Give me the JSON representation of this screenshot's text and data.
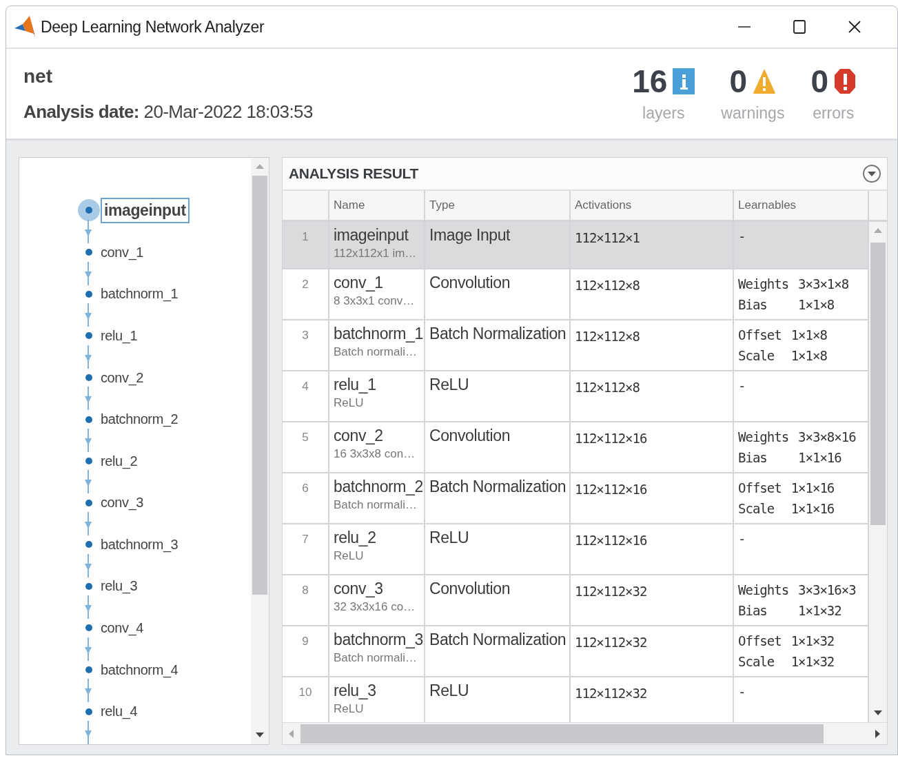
{
  "window": {
    "title": "Deep Learning Network Analyzer"
  },
  "header": {
    "network": "net",
    "date_label": "Analysis date:",
    "date_value": "20-Mar-2022 18:03:53"
  },
  "summary": [
    {
      "kind": "info",
      "count": "16",
      "label": "layers"
    },
    {
      "kind": "warning",
      "count": "0",
      "label": "warnings"
    },
    {
      "kind": "error",
      "count": "0",
      "label": "errors"
    }
  ],
  "graph": {
    "nodes": [
      {
        "label": "imageinput",
        "selected": true
      },
      {
        "label": "conv_1",
        "selected": false
      },
      {
        "label": "batchnorm_1",
        "selected": false
      },
      {
        "label": "relu_1",
        "selected": false
      },
      {
        "label": "conv_2",
        "selected": false
      },
      {
        "label": "batchnorm_2",
        "selected": false
      },
      {
        "label": "relu_2",
        "selected": false
      },
      {
        "label": "conv_3",
        "selected": false
      },
      {
        "label": "batchnorm_3",
        "selected": false
      },
      {
        "label": "relu_3",
        "selected": false
      },
      {
        "label": "conv_4",
        "selected": false
      },
      {
        "label": "batchnorm_4",
        "selected": false
      },
      {
        "label": "relu_4",
        "selected": false
      }
    ]
  },
  "analysis": {
    "title": "ANALYSIS RESULT",
    "columns": [
      "Name",
      "Type",
      "Activations",
      "Learnables"
    ],
    "rows": [
      {
        "index": "1",
        "name": "imageinput",
        "description": "112x112x1 im…",
        "type": "Image Input",
        "activations": "112×112×1",
        "learnables": [
          {
            "name": "-"
          }
        ],
        "selected": true
      },
      {
        "index": "2",
        "name": "conv_1",
        "description": "8 3x3x1 conv…",
        "type": "Convolution",
        "activations": "112×112×8",
        "learnables": [
          {
            "name": "Weights",
            "size": "3×3×1×8"
          },
          {
            "name": "Bias",
            "size": "1×1×8"
          }
        ],
        "selected": false
      },
      {
        "index": "3",
        "name": "batchnorm_1",
        "description": "Batch normali…",
        "type": "Batch Normalization",
        "activations": "112×112×8",
        "learnables": [
          {
            "name": "Offset",
            "size": "1×1×8"
          },
          {
            "name": "Scale",
            "size": "1×1×8"
          }
        ],
        "selected": false
      },
      {
        "index": "4",
        "name": "relu_1",
        "description": "ReLU",
        "type": "ReLU",
        "activations": "112×112×8",
        "learnables": [
          {
            "name": "-"
          }
        ],
        "selected": false
      },
      {
        "index": "5",
        "name": "conv_2",
        "description": "16 3x3x8 con…",
        "type": "Convolution",
        "activations": "112×112×16",
        "learnables": [
          {
            "name": "Weights",
            "size": "3×3×8×16"
          },
          {
            "name": "Bias",
            "size": "1×1×16"
          }
        ],
        "selected": false
      },
      {
        "index": "6",
        "name": "batchnorm_2",
        "description": "Batch normali…",
        "type": "Batch Normalization",
        "activations": "112×112×16",
        "learnables": [
          {
            "name": "Offset",
            "size": "1×1×16"
          },
          {
            "name": "Scale",
            "size": "1×1×16"
          }
        ],
        "selected": false
      },
      {
        "index": "7",
        "name": "relu_2",
        "description": "ReLU",
        "type": "ReLU",
        "activations": "112×112×16",
        "learnables": [
          {
            "name": "-"
          }
        ],
        "selected": false
      },
      {
        "index": "8",
        "name": "conv_3",
        "description": "32 3x3x16 co…",
        "type": "Convolution",
        "activations": "112×112×32",
        "learnables": [
          {
            "name": "Weights",
            "size": "3×3×16×3"
          },
          {
            "name": "Bias",
            "size": "1×1×32"
          }
        ],
        "selected": false
      },
      {
        "index": "9",
        "name": "batchnorm_3",
        "description": "Batch normali…",
        "type": "Batch Normalization",
        "activations": "112×112×32",
        "learnables": [
          {
            "name": "Offset",
            "size": "1×1×32"
          },
          {
            "name": "Scale",
            "size": "1×1×32"
          }
        ],
        "selected": false
      },
      {
        "index": "10",
        "name": "relu_3",
        "description": "ReLU",
        "type": "ReLU",
        "activations": "112×112×32",
        "learnables": [
          {
            "name": "-"
          }
        ],
        "selected": false
      }
    ]
  }
}
